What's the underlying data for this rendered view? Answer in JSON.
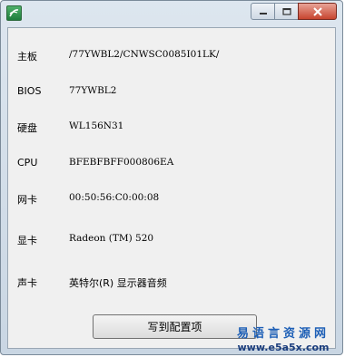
{
  "window": {
    "controls": {
      "minimize_icon": "minimize-icon",
      "maximize_icon": "maximize-icon",
      "close_icon": "close-icon"
    }
  },
  "info": {
    "rows": [
      {
        "label": "主板",
        "value": "/77YWBL2/CNWSC0085I01LK/"
      },
      {
        "label": "BIOS",
        "value": "77YWBL2"
      },
      {
        "label": "硬盘",
        "value": "WL156N31"
      },
      {
        "label": "CPU",
        "value": "BFEBFBFF000806EA"
      },
      {
        "label": "网卡",
        "value": "00:50:56:C0:00:08"
      },
      {
        "label": "显卡",
        "value": "Radeon (TM) 520"
      },
      {
        "label": "声卡",
        "value": "英特尔(R) 显示器音频"
      }
    ]
  },
  "actions": {
    "write_config_label": "写到配置项"
  },
  "watermark": {
    "title": "易语言资源网",
    "url": "www.e5a5x.com"
  },
  "colors": {
    "client_bg": "#f0f0f0",
    "close_button": "#c7452f",
    "watermark_title": "#1d5fb6"
  }
}
